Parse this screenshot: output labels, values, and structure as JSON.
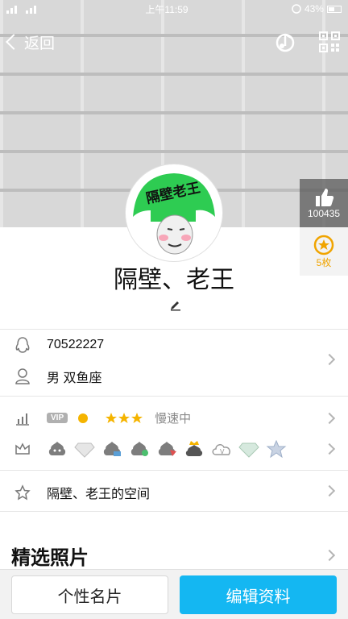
{
  "status_bar": {
    "time": "上午11:59",
    "battery": "43%"
  },
  "topbar": {
    "back_label": "返回"
  },
  "stats": {
    "likes": "100435",
    "stars": "5枚"
  },
  "profile": {
    "avatar_text": "隔壁老王",
    "nickname": "隔壁、老王",
    "qq_number": "70522227",
    "gender_sign": "男  双鱼座"
  },
  "vip": {
    "tag": "VIP",
    "speed": "慢速中"
  },
  "space": {
    "label": "隔壁、老王的空间"
  },
  "photos": {
    "title": "精选照片"
  },
  "bottom": {
    "card_label": "个性名片",
    "edit_label": "编辑资料"
  },
  "colors": {
    "accent": "#14b7f2",
    "avatar_green": "#2ecc52",
    "star": "#f0a400"
  }
}
